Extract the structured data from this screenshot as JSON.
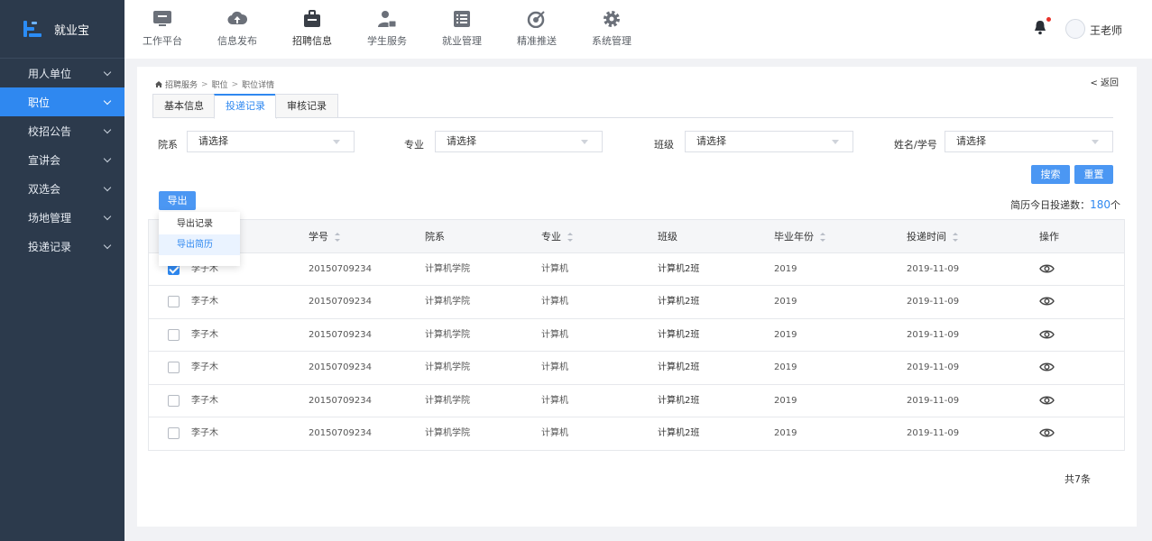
{
  "brand": {
    "name": "就业宝",
    "accent": "#2f88f0",
    "sidebar_bg": "#2c3a4c"
  },
  "sidebar": {
    "items": [
      {
        "label": "用人单位",
        "active": false
      },
      {
        "label": "职位",
        "active": true
      },
      {
        "label": "校招公告",
        "active": false
      },
      {
        "label": "宣讲会",
        "active": false
      },
      {
        "label": "双选会",
        "active": false
      },
      {
        "label": "场地管理",
        "active": false
      },
      {
        "label": "投递记录",
        "active": false
      }
    ]
  },
  "topnav": {
    "items": [
      {
        "label": "工作平台",
        "icon": "monitor-icon"
      },
      {
        "label": "信息发布",
        "icon": "cloud-upload-icon"
      },
      {
        "label": "招聘信息",
        "icon": "briefcase-icon",
        "active": true
      },
      {
        "label": "学生服务",
        "icon": "user-card-icon"
      },
      {
        "label": "就业管理",
        "icon": "list-icon"
      },
      {
        "label": "精准推送",
        "icon": "target-icon"
      },
      {
        "label": "系统管理",
        "icon": "gear-icon"
      }
    ],
    "user": {
      "name": "王老师"
    }
  },
  "breadcrumb": {
    "items": [
      "招聘服务",
      "职位",
      "职位详情"
    ],
    "separator": ">"
  },
  "back_label": "< 返回",
  "tabs": [
    {
      "label": "基本信息"
    },
    {
      "label": "投递记录",
      "active": true
    },
    {
      "label": "审核记录"
    }
  ],
  "filters": [
    {
      "label": "院系",
      "placeholder": "请选择"
    },
    {
      "label": "专业",
      "placeholder": "请选择"
    },
    {
      "label": "班级",
      "placeholder": "请选择"
    },
    {
      "label": "姓名/学号",
      "placeholder": "请选择"
    }
  ],
  "buttons": {
    "search": "搜索",
    "reset": "重置",
    "export": "导出"
  },
  "export_menu": {
    "items": [
      "导出记录",
      "导出简历"
    ],
    "highlighted": "导出简历"
  },
  "summary": {
    "label": "简历今日投递数：",
    "value": "180",
    "unit": "个"
  },
  "table": {
    "columns": [
      {
        "label": "",
        "key": "name"
      },
      {
        "label": "学号",
        "sortable": true
      },
      {
        "label": "院系"
      },
      {
        "label": "专业",
        "sortable": true
      },
      {
        "label": "班级"
      },
      {
        "label": "毕业年份",
        "sortable": true
      },
      {
        "label": "投递时间",
        "sortable": true
      },
      {
        "label": "操作"
      }
    ],
    "rows": [
      {
        "checked": true,
        "name": "李子木",
        "id": "20150709234",
        "dept": "计算机学院",
        "major": "计算机",
        "class": "计算机2班",
        "year": "2019",
        "date": "2019-11-09"
      },
      {
        "checked": false,
        "name": "李子木",
        "id": "20150709234",
        "dept": "计算机学院",
        "major": "计算机",
        "class": "计算机2班",
        "year": "2019",
        "date": "2019-11-09"
      },
      {
        "checked": false,
        "name": "李子木",
        "id": "20150709234",
        "dept": "计算机学院",
        "major": "计算机",
        "class": "计算机2班",
        "year": "2019",
        "date": "2019-11-09"
      },
      {
        "checked": false,
        "name": "李子木",
        "id": "20150709234",
        "dept": "计算机学院",
        "major": "计算机",
        "class": "计算机2班",
        "year": "2019",
        "date": "2019-11-09"
      },
      {
        "checked": false,
        "name": "李子木",
        "id": "20150709234",
        "dept": "计算机学院",
        "major": "计算机",
        "class": "计算机2班",
        "year": "2019",
        "date": "2019-11-09"
      },
      {
        "checked": false,
        "name": "李子木",
        "id": "20150709234",
        "dept": "计算机学院",
        "major": "计算机",
        "class": "计算机2班",
        "year": "2019",
        "date": "2019-11-09"
      }
    ],
    "action_icon": "eye-icon"
  },
  "total_label": "共7条"
}
